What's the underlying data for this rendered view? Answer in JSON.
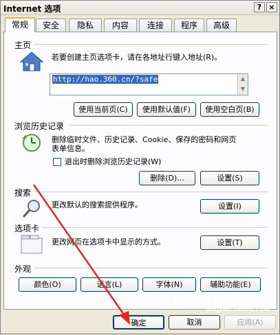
{
  "window": {
    "title": "Internet 选项",
    "help_label": "?",
    "close_label": "×"
  },
  "tabs": [
    {
      "label": "常规"
    },
    {
      "label": "安全"
    },
    {
      "label": "隐私"
    },
    {
      "label": "内容"
    },
    {
      "label": "连接"
    },
    {
      "label": "程序"
    },
    {
      "label": "高级"
    }
  ],
  "homepage": {
    "group_label": "主页",
    "description": "若要创建主页选项卡，请在各地址行键入地址(R)。",
    "url": "http://hao.360.cn/?safe",
    "buttons": {
      "use_current": "使用当前页(C)",
      "use_default": "使用默认值(F)",
      "use_blank": "使用空白页(B)"
    }
  },
  "history": {
    "group_label": "浏览历史记录",
    "description_line1": "删除临时文件、历史记录、Cookie、保存的密码和网页",
    "description_line2": "表单信息。",
    "checkbox_label": "退出时删除浏览历史记录(W)",
    "delete_button": "删除(D)...",
    "settings_button": "设置(S)"
  },
  "search": {
    "group_label": "搜索",
    "description": "更改默认的搜索提供程序。",
    "settings_button": "设置(I)"
  },
  "tabs_group": {
    "group_label": "选项卡",
    "description": "更改网页在选项卡中显示的方式。",
    "settings_button": "设置(T)"
  },
  "appearance": {
    "group_label": "外观",
    "buttons": {
      "colors": "颜色(O)",
      "languages": "语言(L)",
      "fonts": "字体(N)",
      "accessibility": "辅助功能(E)"
    }
  },
  "footer": {
    "ok": "确定",
    "cancel": "取消",
    "apply": "应用(A)"
  },
  "watermark": {
    "brand": "Bai du 经验",
    "sub": "jingyan.baidu.com"
  },
  "colors": {
    "accent_tab": "#f9b236",
    "selection": "#316ac5",
    "annotation_arrow": "#e8261c"
  }
}
